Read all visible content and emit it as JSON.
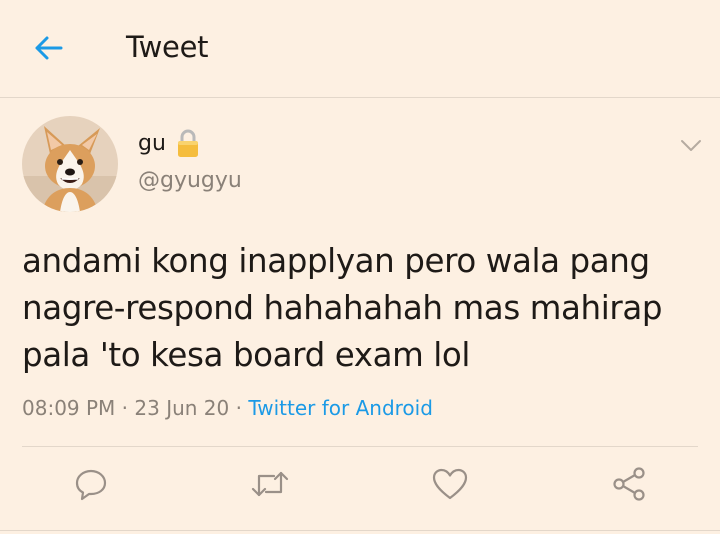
{
  "header": {
    "title": "Tweet",
    "back_icon": "arrow-left-icon"
  },
  "tweet": {
    "author": {
      "display_name": "gu",
      "handle": "@gyugyu",
      "protected_icon": "lock-icon"
    },
    "text_lines": [
      "andami kong inapplyan pero wala pang",
      "nagre-respond hahahahah mas mahirap",
      "pala 'to kesa board exam lol"
    ],
    "time": "08:09 PM",
    "date": "23 Jun 20",
    "separator": "·",
    "source": "Twitter for Android"
  },
  "actions": [
    {
      "name": "reply",
      "icon": "reply-icon"
    },
    {
      "name": "retweet",
      "icon": "retweet-icon"
    },
    {
      "name": "like",
      "icon": "heart-icon"
    },
    {
      "name": "share",
      "icon": "share-icon"
    }
  ],
  "colors": {
    "background": "#fdf0e2",
    "accent": "#1b9ae6",
    "text": "#1e1a17",
    "muted": "#8a8178",
    "divider": "#e3d7ca"
  }
}
